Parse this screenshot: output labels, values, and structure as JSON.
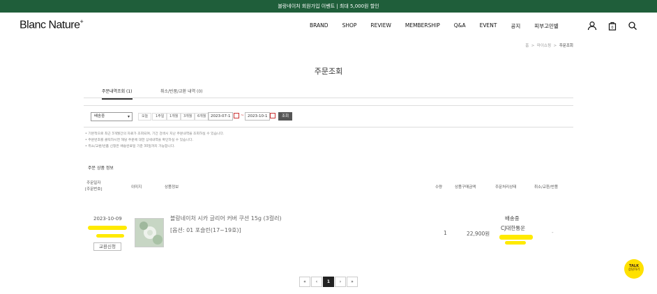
{
  "topbar": {
    "text": "블랑네이처 회원가입 이벤트 | 최대 5,000원 할인"
  },
  "header": {
    "logo": "Blanc Nature",
    "logo_sup": "+",
    "nav": [
      "BRAND",
      "SHOP",
      "REVIEW",
      "MEMBERSHIP",
      "Q&A",
      "EVENT",
      "공지",
      "피부고민별"
    ]
  },
  "breadcrumb": {
    "home": "홈",
    "mypage": "마이쇼핑",
    "current": "주문조회"
  },
  "page": {
    "title": "주문조회"
  },
  "tabs": [
    {
      "label": "주문내역조회 (1)"
    },
    {
      "label": "취소/반품/교환 내역 (0)"
    }
  ],
  "filter": {
    "select_value": "배송중",
    "periods": [
      "오늘",
      "1주일",
      "1개월",
      "3개월",
      "6개월"
    ],
    "date_from": "2023-07-1",
    "date_to": "2023-10-1",
    "search_label": "조회"
  },
  "notes": [
    "• 기본적으로 최근 3개월간의 자료가 조회되며, 기간 검색시 지난 주문내역을 조회하실 수 있습니다.",
    "• 주문번호를 클릭하시면 해당 주문에 대한 상세내역을 확인하실 수 있습니다.",
    "• 취소/교환/반품 신청은 배송완료일 기준 30일까지 가능합니다."
  ],
  "section": {
    "title": "주문 상품 정보"
  },
  "table": {
    "headers": [
      "주문일자\n[주문번호]",
      "이미지",
      "상품정보",
      "수량",
      "상품구매금액",
      "주문처리상태",
      "취소/교환/반품"
    ],
    "row": {
      "date": "2023-10-09",
      "exchange_button": "교환신청",
      "product_name": "블랑네이처 시카 글리어 커버 쿠션 15g (3컬러)",
      "option": "[옵션: 01 포슬린(17~19호)]",
      "qty": "1",
      "price": "22,900원",
      "status": "배송중",
      "carrier": "CJ대한통운",
      "cancel": "-"
    }
  },
  "pagination": {
    "first": "«",
    "prev": "‹",
    "current": "1",
    "next": "›",
    "last": "»"
  },
  "kakao": {
    "line1": "TALK",
    "line2": "상담하기"
  }
}
